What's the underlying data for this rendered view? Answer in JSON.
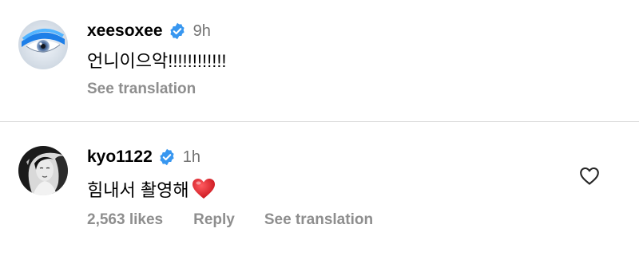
{
  "comments": [
    {
      "username": "xeesoxee",
      "verified": true,
      "time": "9h",
      "text": "언니이으악!!!!!!!!!!!!",
      "see_translation": "See translation",
      "avatar_icon": "blue-eye-avatar"
    },
    {
      "username": "kyo1122",
      "verified": true,
      "time": "1h",
      "text": "힘내서 촬영해",
      "emoji": "red-heart-emoji",
      "likes": "2,563 likes",
      "reply": "Reply",
      "see_translation": "See translation",
      "avatar_icon": "black-white-portrait-avatar",
      "like_icon": "heart-outline-icon"
    }
  ],
  "colors": {
    "verified_badge": "#3897f0",
    "secondary_text": "#737373",
    "action_text": "#8e8e8e",
    "divider": "#dbdbdb",
    "heart_emoji": "#e0262b"
  }
}
